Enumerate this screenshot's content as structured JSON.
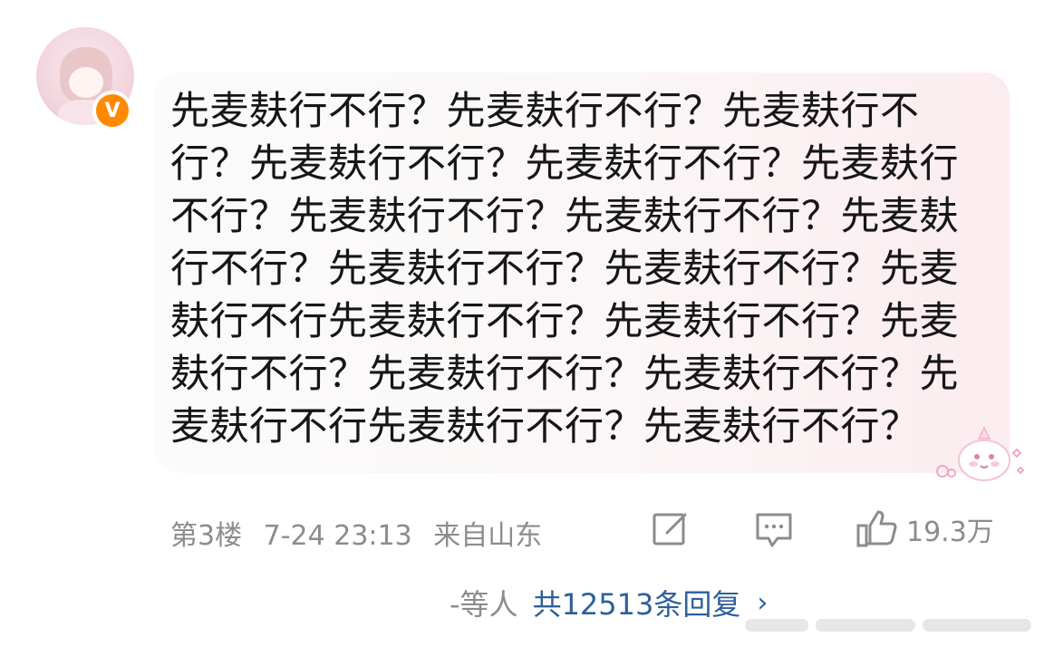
{
  "comment": {
    "text": "先麦麸行不行？先麦麸行不行？先麦麸行不行？先麦麸行不行？先麦麸行不行？先麦麸行不行？先麦麸行不行？先麦麸行不行？先麦麸行不行？先麦麸行不行？先麦麸行不行？先麦麸行不行先麦麸行不行？先麦麸行不行？先麦麸行不行？先麦麸行不行？先麦麸行不行？先麦麸行不行先麦麸行不行？先麦麸行不行？",
    "verified_badge": "V"
  },
  "meta": {
    "floor": "第3楼",
    "datetime": "7-24 23:13",
    "location": "来自山东"
  },
  "actions": {
    "like_count": "19.3万",
    "icons": [
      "edit-icon",
      "comment-icon",
      "like-icon"
    ]
  },
  "replies": {
    "names": "-等人",
    "count_text": "共12513条回复",
    "chevron": "›"
  },
  "colors": {
    "accent_blue": "#2f5f9a",
    "meta_gray": "#8c8c8c",
    "badge_orange": "#ff8a00"
  }
}
